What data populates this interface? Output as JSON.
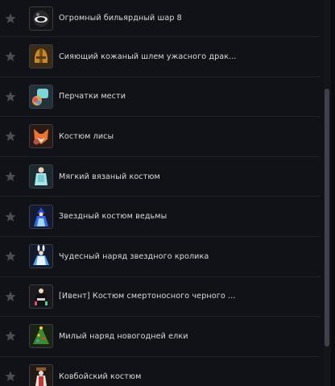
{
  "items": [
    {
      "label": "Огромный бильярдный шар 8",
      "icon": "billiard-ball-icon",
      "favorite": false
    },
    {
      "label": "Сияющий кожаный шлем ужасного драк...",
      "icon": "helmet-icon",
      "favorite": false
    },
    {
      "label": "Перчатки мести",
      "icon": "gloves-icon",
      "favorite": false
    },
    {
      "label": "Костюм лисы",
      "icon": "fox-costume-icon",
      "favorite": false
    },
    {
      "label": "Мягкий вязаный костюм",
      "icon": "knit-costume-icon",
      "favorite": false
    },
    {
      "label": "Звездный костюм ведьмы",
      "icon": "witch-costume-icon",
      "favorite": false
    },
    {
      "label": "Чудесный наряд звездного кролика",
      "icon": "bunny-outfit-icon",
      "favorite": false
    },
    {
      "label": "[Ивент] Костюм смертоносного черного ...",
      "icon": "black-costume-icon",
      "favorite": false
    },
    {
      "label": "Милый наряд новогодней елки",
      "icon": "christmas-tree-outfit-icon",
      "favorite": false
    },
    {
      "label": "Ковбойский костюм",
      "icon": "cowboy-costume-icon",
      "favorite": false
    }
  ]
}
